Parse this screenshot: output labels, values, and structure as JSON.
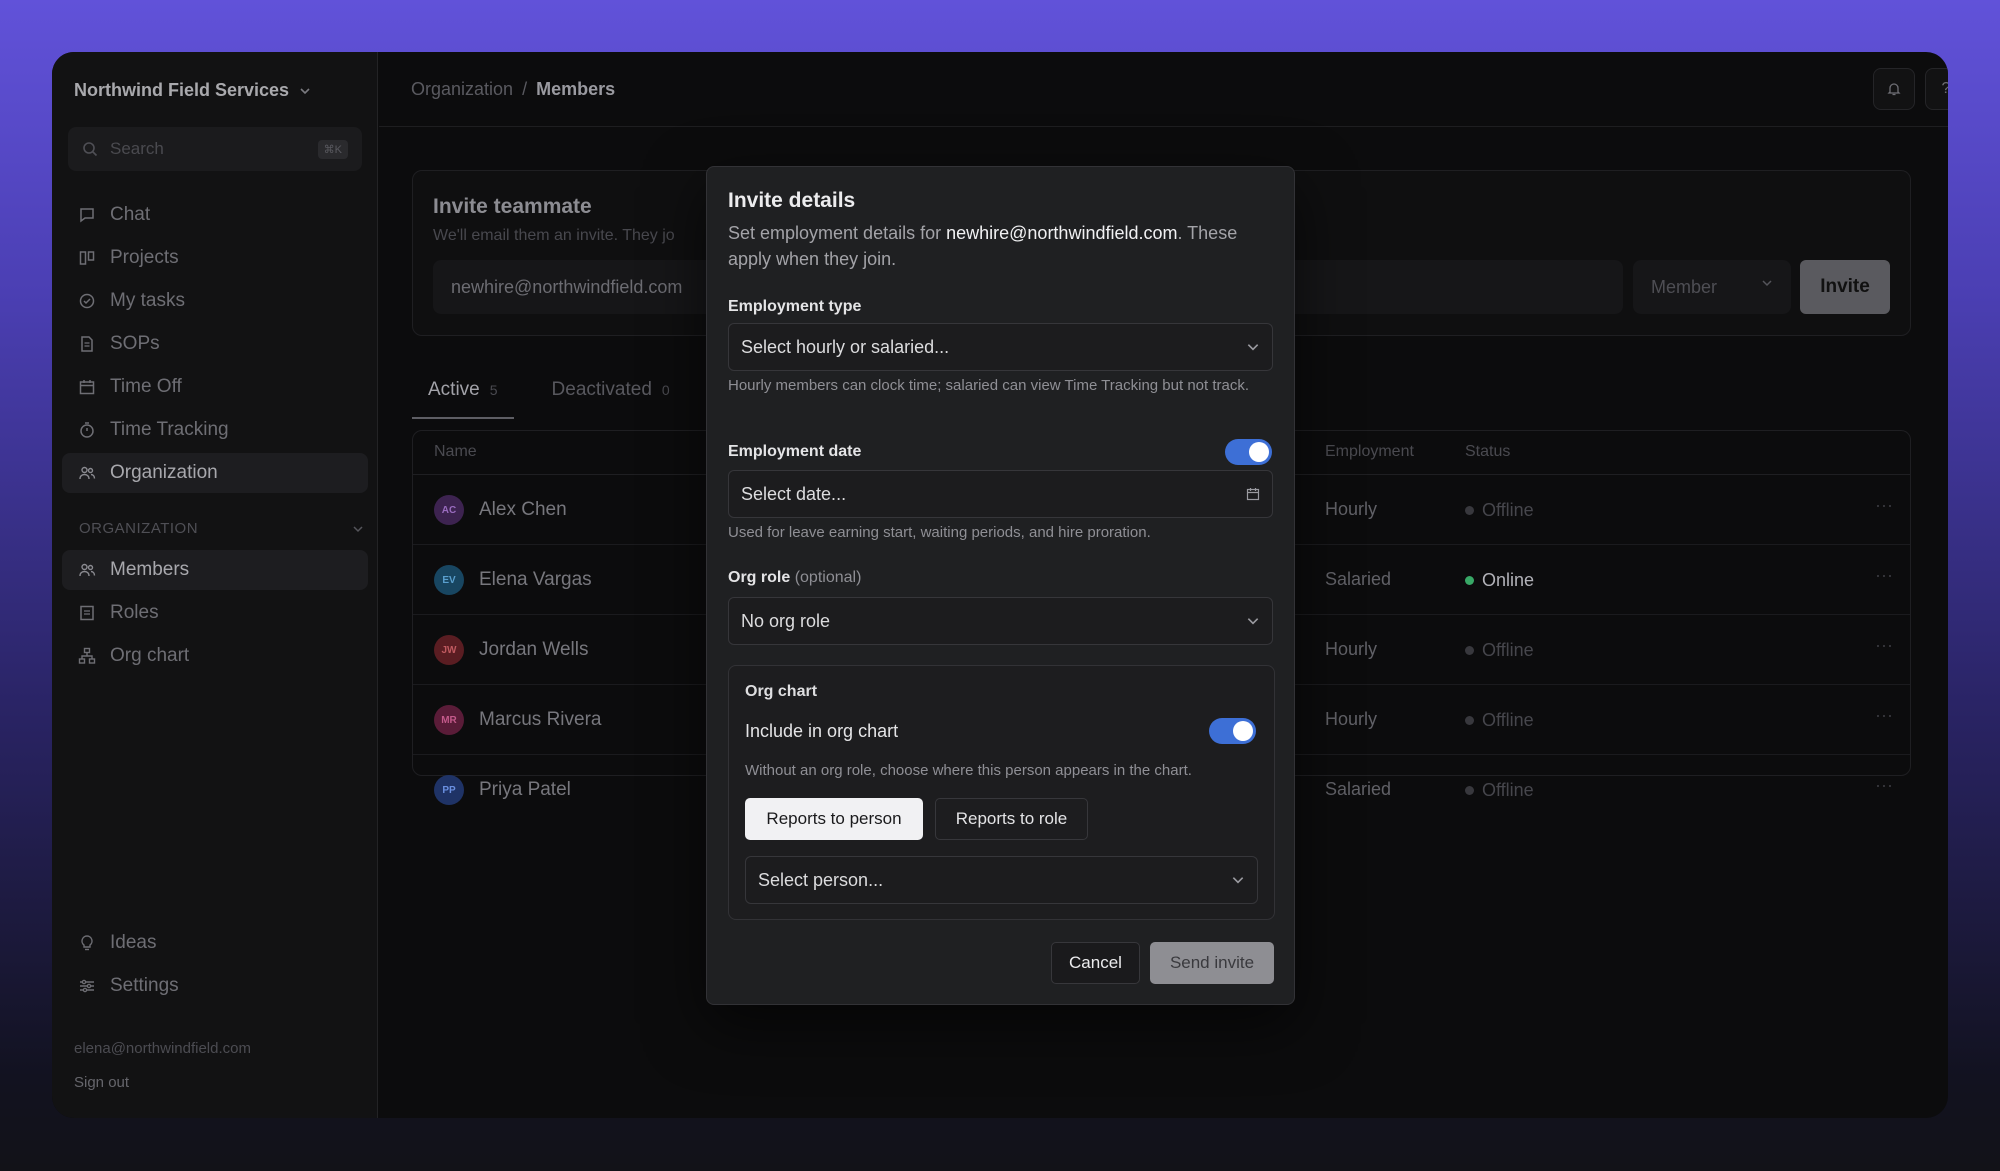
{
  "sidebar": {
    "org_name": "Northwind Field Services",
    "search": {
      "placeholder": "Search",
      "shortcut": "⌘K"
    },
    "nav": [
      {
        "label": "Chat",
        "icon": "chat-icon"
      },
      {
        "label": "Projects",
        "icon": "projects-icon"
      },
      {
        "label": "My tasks",
        "icon": "check-circle-icon"
      },
      {
        "label": "SOPs",
        "icon": "document-icon"
      },
      {
        "label": "Time Off",
        "icon": "calendar-icon"
      },
      {
        "label": "Time Tracking",
        "icon": "stopwatch-icon"
      },
      {
        "label": "Organization",
        "icon": "people-icon",
        "active": true
      }
    ],
    "section_label": "ORGANIZATION",
    "org_nav": [
      {
        "label": "Members",
        "icon": "people-icon",
        "active": true
      },
      {
        "label": "Roles",
        "icon": "list-icon"
      },
      {
        "label": "Org chart",
        "icon": "hierarchy-icon"
      }
    ],
    "bottom_nav": [
      {
        "label": "Ideas",
        "icon": "lightbulb-icon"
      },
      {
        "label": "Settings",
        "icon": "sliders-icon"
      }
    ],
    "user_email": "elena@northwindfield.com",
    "sign_out": "Sign out"
  },
  "header": {
    "breadcrumb": {
      "parent": "Organization",
      "separator": "/",
      "current": "Members"
    },
    "help_label": "?"
  },
  "invite_card": {
    "title": "Invite teammate",
    "subtitle": "We'll email them an invite. They jo",
    "email_value": "newhire@northwindfield.com",
    "role_value": "Member",
    "invite_label": "Invite"
  },
  "tabs": [
    {
      "label": "Active",
      "count": "5"
    },
    {
      "label": "Deactivated",
      "count": "0"
    }
  ],
  "table": {
    "headers": {
      "name": "Name",
      "employment": "Employment",
      "status": "Status"
    },
    "rows": [
      {
        "initials": "AC",
        "name": "Alex Chen",
        "employment": "Hourly",
        "status": "Offline",
        "avatar_color": "#7a3fa0"
      },
      {
        "initials": "EV",
        "name": "Elena Vargas",
        "employment": "Salaried",
        "status": "Online",
        "avatar_color": "#2b7fb0"
      },
      {
        "initials": "JW",
        "name": "Jordan Wells",
        "employment": "Hourly",
        "status": "Offline",
        "avatar_color": "#b0323a"
      },
      {
        "initials": "MR",
        "name": "Marcus Rivera",
        "employment": "Hourly",
        "status": "Offline",
        "avatar_color": "#b03064"
      },
      {
        "initials": "PP",
        "name": "Priya Patel",
        "employment": "Salaried",
        "status": "Offline",
        "avatar_color": "#3a5fc0"
      }
    ],
    "more_label": "···"
  },
  "modal": {
    "title": "Invite details",
    "desc_prefix": "Set employment details for ",
    "desc_email": "newhire@northwindfield.com",
    "desc_suffix": ". These apply when they join.",
    "employment_type": {
      "label": "Employment type",
      "placeholder": "Select hourly or salaried...",
      "help": "Hourly members can clock time; salaried can view Time Tracking but not track."
    },
    "employment_date": {
      "label": "Employment date",
      "toggle_on": true,
      "placeholder": "Select date...",
      "help": "Used for leave earning start, waiting periods, and hire proration."
    },
    "org_role": {
      "label": "Org role",
      "optional": "(optional)",
      "value": "No org role"
    },
    "org_chart": {
      "title": "Org chart",
      "include_label": "Include in org chart",
      "include_on": true,
      "help": "Without an org role, choose where this person appears in the chart.",
      "option_person": "Reports to person",
      "option_role": "Reports to role",
      "selected_option": "Reports to person",
      "person_placeholder": "Select person..."
    },
    "cancel_label": "Cancel",
    "send_label": "Send invite"
  },
  "colors": {
    "accent_toggle": "#3d6fd6",
    "online": "#38a866",
    "backdrop_top": "#6152d9"
  }
}
